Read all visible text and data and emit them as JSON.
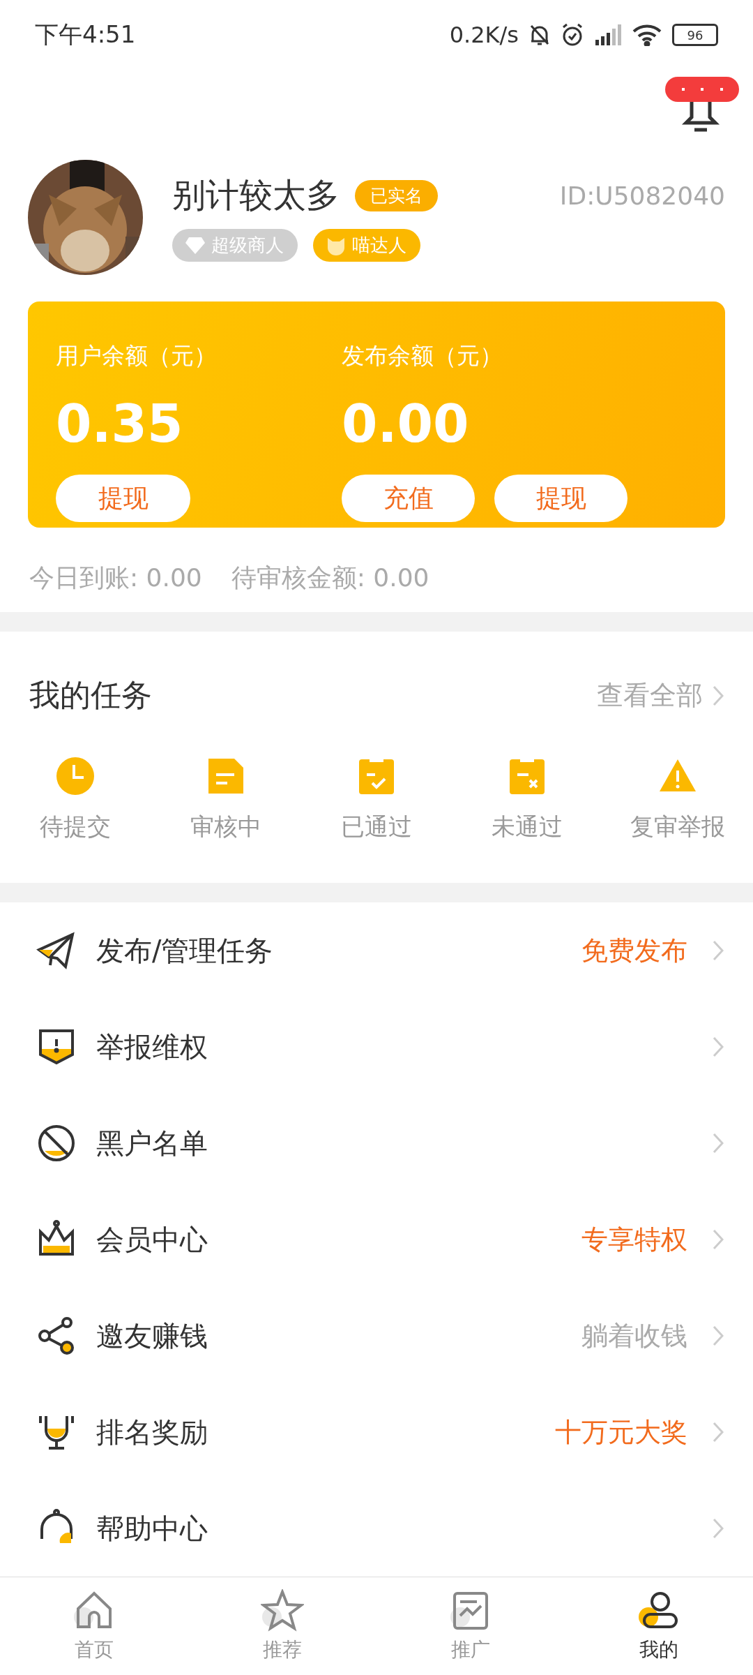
{
  "status_bar": {
    "time": "下午4:51",
    "speed": "0.2K/s",
    "battery": "96"
  },
  "profile": {
    "name": "别计较太多",
    "verified": "已实名",
    "id": "ID:U5082040",
    "tags": [
      {
        "kind": "diamond",
        "label": "超级商人"
      },
      {
        "kind": "cat",
        "label": "喵达人"
      }
    ]
  },
  "wallet": {
    "columns": [
      {
        "label": "用户余额（元）",
        "amount": "0.35",
        "buttons": [
          "提现"
        ]
      },
      {
        "label": "发布余额（元）",
        "amount": "0.00",
        "buttons": [
          "充值",
          "提现"
        ]
      }
    ]
  },
  "summary": [
    "今日到账: 0.00",
    "待审核金额: 0.00"
  ],
  "tasks": {
    "title": "我的任务",
    "more": "查看全部",
    "items": [
      {
        "kind": "clock",
        "label": "待提交"
      },
      {
        "kind": "doc",
        "label": "审核中"
      },
      {
        "kind": "passed",
        "label": "已通过"
      },
      {
        "kind": "failed",
        "label": "未通过"
      },
      {
        "kind": "warning",
        "label": "复审举报"
      }
    ]
  },
  "menu": [
    {
      "kind": "plane",
      "label": "发布/管理任务",
      "note": "免费发布",
      "highlight": true
    },
    {
      "kind": "shield",
      "label": "举报维权"
    },
    {
      "kind": "ban",
      "label": "黑户名单"
    },
    {
      "kind": "crown",
      "label": "会员中心",
      "note": "专享特权",
      "highlight": true
    },
    {
      "kind": "share",
      "label": "邀友赚钱",
      "note": "躺着收钱",
      "highlight": false
    },
    {
      "kind": "trophy",
      "label": "排名奖励",
      "note": "十万元大奖",
      "highlight": true
    },
    {
      "kind": "headset",
      "label": "帮助中心"
    }
  ],
  "tab_bar": [
    {
      "kind": "home",
      "label": "首页",
      "selected": false
    },
    {
      "kind": "star",
      "label": "推荐",
      "selected": false
    },
    {
      "kind": "chart",
      "label": "推广",
      "selected": false
    },
    {
      "kind": "user",
      "label": "我的",
      "selected": true
    }
  ]
}
